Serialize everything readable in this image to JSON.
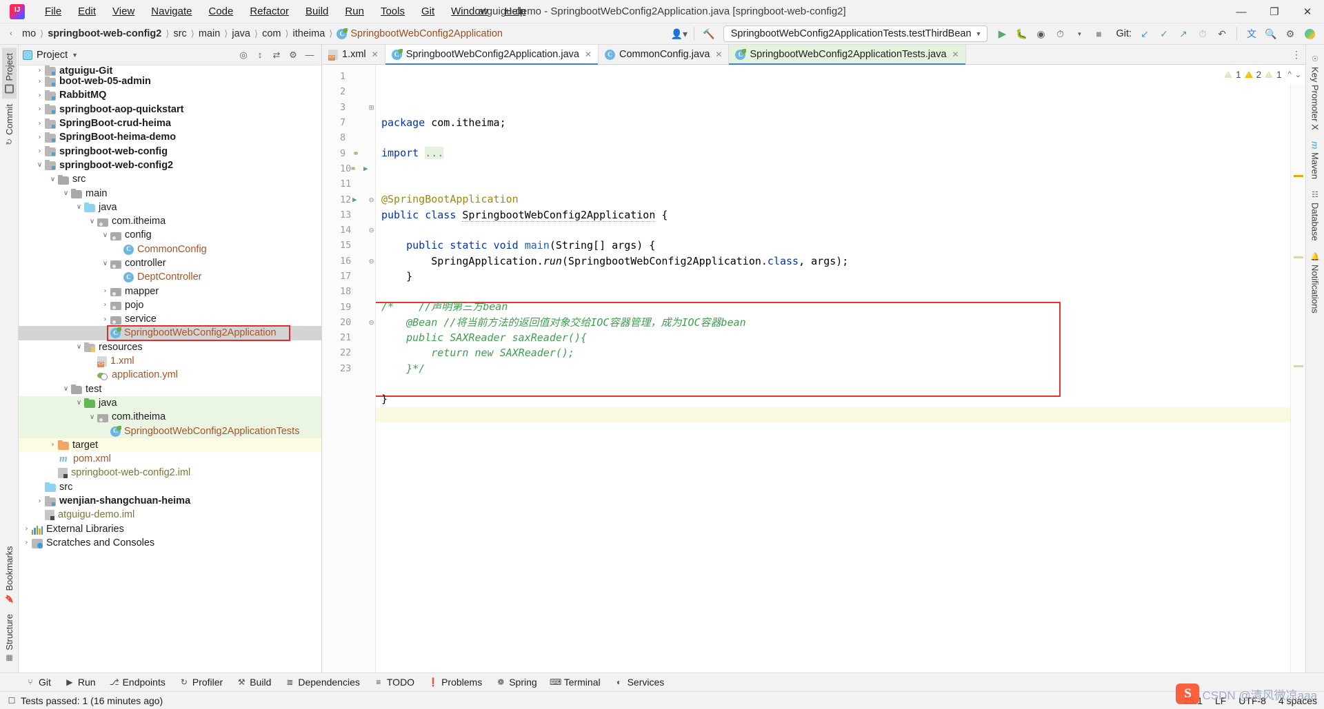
{
  "window": {
    "title": "atguigu-demo - SpringbootWebConfig2Application.java [springboot-web-config2]",
    "minimize": "—",
    "maximize": "❐",
    "close": "✕"
  },
  "menubar": {
    "items": [
      "File",
      "Edit",
      "View",
      "Navigate",
      "Code",
      "Refactor",
      "Build",
      "Run",
      "Tools",
      "Git",
      "Window",
      "Help"
    ]
  },
  "navbar": {
    "crumbs": [
      {
        "label": "mo",
        "bold": false
      },
      {
        "label": "springboot-web-config2",
        "bold": true
      },
      {
        "label": "src",
        "bold": false
      },
      {
        "label": "main",
        "bold": false
      },
      {
        "label": "java",
        "bold": false
      },
      {
        "label": "com",
        "bold": false
      },
      {
        "label": "itheima",
        "bold": false
      }
    ],
    "class_crumb": "SpringbootWebConfig2Application",
    "run_config": "SpringbootWebConfig2ApplicationTests.testThirdBean",
    "git_label": "Git:"
  },
  "left_rail": {
    "project_tab": "Project",
    "commit_tab": "Commit",
    "bookmarks_tab": "Bookmarks",
    "structure_tab": "Structure"
  },
  "right_rail": {
    "items": [
      "Key Promoter X",
      "Maven",
      "Database",
      "Notifications"
    ]
  },
  "project_panel": {
    "header_title": "Project",
    "tree": [
      {
        "depth": 1,
        "label": "atguigu-Git",
        "icon": "module-folder-icon",
        "arrow": "›",
        "bold": true,
        "cut": true
      },
      {
        "depth": 1,
        "label": "boot-web-05-admin",
        "icon": "module-folder-icon",
        "arrow": "›",
        "bold": true
      },
      {
        "depth": 1,
        "label": "RabbitMQ",
        "icon": "module-folder-icon",
        "arrow": "›",
        "bold": true
      },
      {
        "depth": 1,
        "label": "springboot-aop-quickstart",
        "icon": "module-folder-icon",
        "arrow": "›",
        "bold": true
      },
      {
        "depth": 1,
        "label": "SpringBoot-crud-heima",
        "icon": "module-folder-icon",
        "arrow": "›",
        "bold": true
      },
      {
        "depth": 1,
        "label": "SpringBoot-heima-demo",
        "icon": "module-folder-icon",
        "arrow": "›",
        "bold": true
      },
      {
        "depth": 1,
        "label": "springboot-web-config",
        "icon": "module-folder-icon",
        "arrow": "›",
        "bold": true
      },
      {
        "depth": 1,
        "label": "springboot-web-config2",
        "icon": "module-folder-icon",
        "arrow": "∨",
        "bold": true
      },
      {
        "depth": 2,
        "label": "src",
        "icon": "folder-gray-icon",
        "arrow": "∨"
      },
      {
        "depth": 3,
        "label": "main",
        "icon": "folder-gray-icon",
        "arrow": "∨"
      },
      {
        "depth": 4,
        "label": "java",
        "icon": "folder-blue-icon",
        "arrow": "∨"
      },
      {
        "depth": 5,
        "label": "com.itheima",
        "icon": "package-icon",
        "arrow": "∨"
      },
      {
        "depth": 6,
        "label": "config",
        "icon": "package-icon",
        "arrow": "∨"
      },
      {
        "depth": 7,
        "label": "CommonConfig",
        "icon": "java-class-icon",
        "arrow": "",
        "color": "orange"
      },
      {
        "depth": 6,
        "label": "controller",
        "icon": "package-icon",
        "arrow": "∨"
      },
      {
        "depth": 7,
        "label": "DeptController",
        "icon": "java-class-icon",
        "arrow": "",
        "color": "orange"
      },
      {
        "depth": 6,
        "label": "mapper",
        "icon": "package-icon",
        "arrow": "›"
      },
      {
        "depth": 6,
        "label": "pojo",
        "icon": "package-icon",
        "arrow": "›"
      },
      {
        "depth": 6,
        "label": "service",
        "icon": "package-icon",
        "arrow": "›"
      },
      {
        "depth": 6,
        "label": "SpringbootWebConfig2Application",
        "icon": "spring-class-icon",
        "arrow": "",
        "color": "orange",
        "selected": true,
        "red_outline": true
      },
      {
        "depth": 4,
        "label": "resources",
        "icon": "resources-folder-icon",
        "arrow": "∨"
      },
      {
        "depth": 5,
        "label": "1.xml",
        "icon": "xml-file-icon",
        "arrow": "",
        "color": "orange"
      },
      {
        "depth": 5,
        "label": "application.yml",
        "icon": "yaml-file-icon",
        "arrow": "",
        "color": "orange"
      },
      {
        "depth": 3,
        "label": "test",
        "icon": "folder-gray-icon",
        "arrow": "∨"
      },
      {
        "depth": 4,
        "label": "java",
        "icon": "folder-green-icon",
        "arrow": "∨",
        "test_bg": true
      },
      {
        "depth": 5,
        "label": "com.itheima",
        "icon": "package-icon",
        "arrow": "∨",
        "test_bg": true
      },
      {
        "depth": 6,
        "label": "SpringbootWebConfig2ApplicationTests",
        "icon": "spring-class-icon",
        "arrow": "",
        "color": "orange",
        "test_bg": true
      },
      {
        "depth": 2,
        "label": "target",
        "icon": "folder-orange-icon",
        "arrow": "›",
        "target_bg": true
      },
      {
        "depth": 2,
        "label": "pom.xml",
        "icon": "maven-file-icon",
        "arrow": "",
        "color": "orange"
      },
      {
        "depth": 2,
        "label": "springboot-web-config2.iml",
        "icon": "iml-file-icon",
        "arrow": "",
        "color": "olive"
      },
      {
        "depth": 1,
        "label": "src",
        "icon": "folder-blue-icon",
        "arrow": ""
      },
      {
        "depth": 1,
        "label": "wenjian-shangchuan-heima",
        "icon": "module-folder-icon",
        "arrow": "›",
        "bold": true
      },
      {
        "depth": 1,
        "label": "atguigu-demo.iml",
        "icon": "iml-file-icon",
        "arrow": "",
        "color": "olive"
      },
      {
        "depth": 0,
        "label": "External Libraries",
        "icon": "libraries-icon",
        "arrow": "›"
      },
      {
        "depth": 0,
        "label": "Scratches and Consoles",
        "icon": "scratches-icon",
        "arrow": "›"
      }
    ]
  },
  "editor": {
    "tabs": [
      {
        "label": "1.xml",
        "icon": "xml-file-icon",
        "active": false
      },
      {
        "label": "SpringbootWebConfig2Application.java",
        "icon": "spring-class-icon",
        "active": true
      },
      {
        "label": "CommonConfig.java",
        "icon": "java-class-icon",
        "active": false
      },
      {
        "label": "SpringbootWebConfig2ApplicationTests.java",
        "icon": "spring-class-icon",
        "active": true,
        "green": true
      }
    ],
    "line_numbers": [
      "1",
      "2",
      "3",
      "7",
      "8",
      "9",
      "10",
      "11",
      "12",
      "13",
      "14",
      "15",
      "16",
      "17",
      "18",
      "19",
      "20",
      "21",
      "22",
      "23"
    ],
    "code_lines": [
      {
        "n": "1",
        "html": "<span class=\"kw\">package</span> com.itheima;"
      },
      {
        "n": "2",
        "html": ""
      },
      {
        "n": "3",
        "html": "<span class=\"kw\">import</span> <span class=\"fold-import\">...</span>"
      },
      {
        "n": "7",
        "html": ""
      },
      {
        "n": "8",
        "html": ""
      },
      {
        "n": "9",
        "html": "<span class=\"anno\">@SpringBootApplication</span>"
      },
      {
        "n": "10",
        "html": "<span class=\"kw\">public class</span> <span class=\"squig\">SpringbootWebConfig2Application</span> {"
      },
      {
        "n": "11",
        "html": ""
      },
      {
        "n": "12",
        "html": "    <span class=\"kw\">public static void</span> <span class=\"meth\">main</span>(String[] args) {"
      },
      {
        "n": "13",
        "html": "        SpringApplication.<span class=\"ital\">run</span>(SpringbootWebConfig2Application.<span class=\"kw\">class</span>, args);"
      },
      {
        "n": "14",
        "html": "    }"
      },
      {
        "n": "15",
        "html": ""
      },
      {
        "n": "16",
        "html": "<span class=\"cmt\">/*    //声明第三方bean</span>"
      },
      {
        "n": "17",
        "html": "<span class=\"cmt\">    @Bean //将当前方法的返回值对象交给IOC容器管理，成为IOC容器bean</span>"
      },
      {
        "n": "18",
        "html": "<span class=\"cmt\">    public SAXReader saxReader(){</span>"
      },
      {
        "n": "19",
        "html": "<span class=\"cmt\">        return new SAXReader();</span>"
      },
      {
        "n": "20",
        "html": "<span class=\"cmt\">    }*/</span>"
      },
      {
        "n": "21",
        "html": ""
      },
      {
        "n": "22",
        "html": "}"
      },
      {
        "n": "23",
        "html": ""
      }
    ],
    "inspections": {
      "warn1_count": "1",
      "warn2_count": "2",
      "warn3_count": "1"
    }
  },
  "toolwindows": {
    "items": [
      {
        "label": "Git",
        "icon": "git-branch-icon"
      },
      {
        "label": "Run",
        "icon": "run-play-icon"
      },
      {
        "label": "Endpoints",
        "icon": "endpoints-icon"
      },
      {
        "label": "Profiler",
        "icon": "profiler-icon"
      },
      {
        "label": "Build",
        "icon": "build-hammer-icon"
      },
      {
        "label": "Dependencies",
        "icon": "dependencies-icon"
      },
      {
        "label": "TODO",
        "icon": "todo-list-icon"
      },
      {
        "label": "Problems",
        "icon": "problems-icon"
      },
      {
        "label": "Spring",
        "icon": "spring-leaf-icon"
      },
      {
        "label": "Terminal",
        "icon": "terminal-icon"
      },
      {
        "label": "Services",
        "icon": "services-icon"
      }
    ]
  },
  "statusbar": {
    "message": "Tests passed: 1 (16 minutes ago)",
    "caret": "23:1",
    "line_sep": "LF",
    "encoding": "UTF-8",
    "indent": "4 spaces",
    "watermark_logo": "S",
    "watermark_text": "CSDN @清风微凉aaa"
  },
  "colors": {
    "accent_blue": "#3f7fd1",
    "red_highlight": "#e8332a",
    "comment_green": "#3f9e4e",
    "keyword_blue": "#0033b3",
    "annotation_gold": "#9e880d",
    "test_bg_green": "#eaf5e3",
    "target_bg_yellow": "#fdfbe2"
  }
}
